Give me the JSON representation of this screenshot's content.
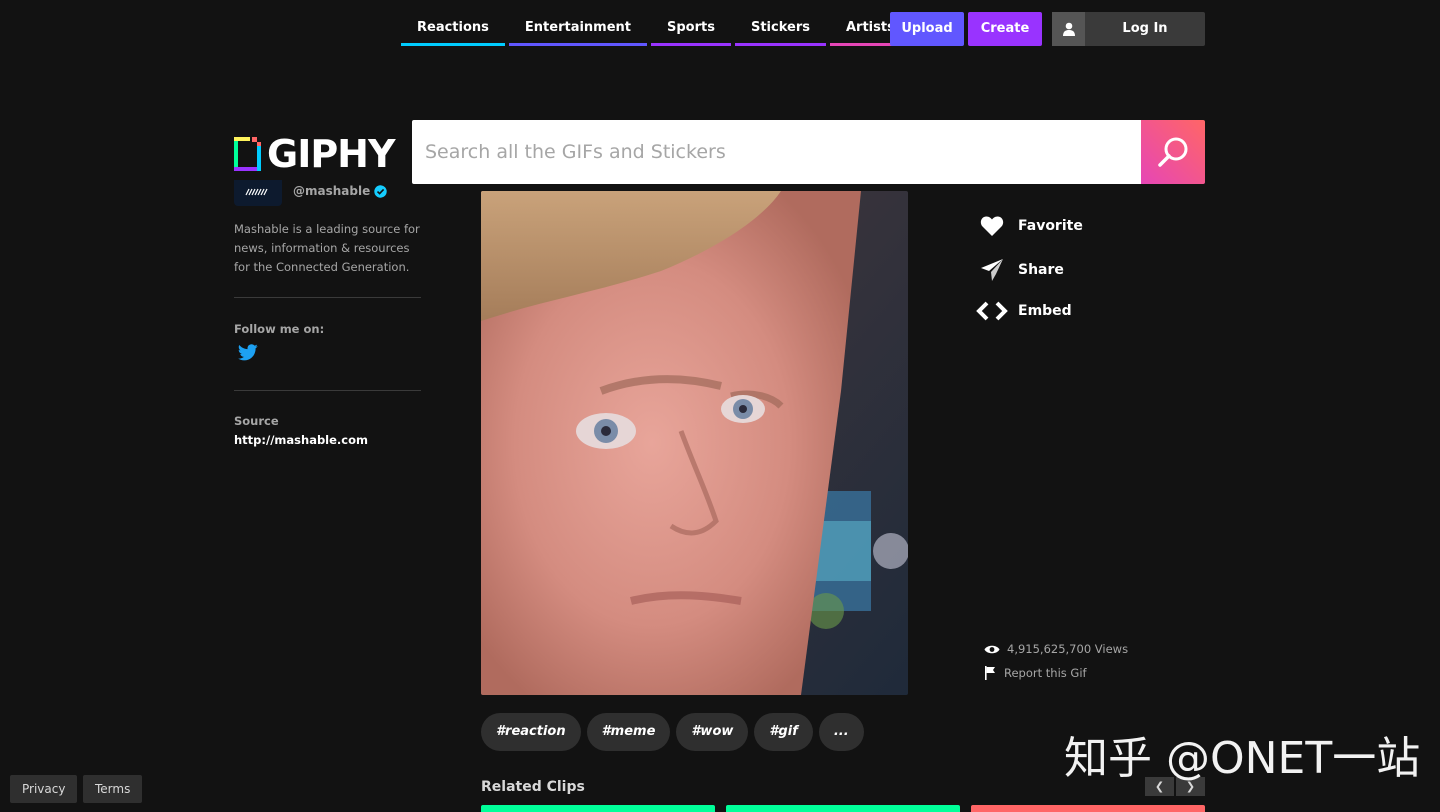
{
  "nav": {
    "items": [
      {
        "label": "Reactions",
        "color": "#00ccff"
      },
      {
        "label": "Entertainment",
        "color": "#6157ff"
      },
      {
        "label": "Sports",
        "color": "#9933ff"
      },
      {
        "label": "Stickers",
        "color": "#9933ff"
      },
      {
        "label": "Artists",
        "color": "#e646b6"
      }
    ],
    "more_color": "#e646b6",
    "upload_label": "Upload",
    "create_label": "Create",
    "login_label": "Log In"
  },
  "logo": {
    "text": "GIPHY"
  },
  "search": {
    "placeholder": "Search all the GIFs and Stickers"
  },
  "channel": {
    "handle": "@mashable",
    "bio": "Mashable is a leading source for news, information & resources for the Connected Generation.",
    "follow_label": "Follow me on:",
    "source_label": "Source",
    "source_link": "http://mashable.com"
  },
  "actions": {
    "favorite": "Favorite",
    "share": "Share",
    "embed": "Embed"
  },
  "stats": {
    "views": "4,915,625,700 Views",
    "report": "Report this Gif"
  },
  "tags": [
    "#reaction",
    "#meme",
    "#wow",
    "#gif",
    "..."
  ],
  "related": {
    "title": "Related Clips",
    "clip_colors": [
      "#00ff99",
      "#00ff99",
      "#ff6666"
    ]
  },
  "footer": {
    "privacy": "Privacy",
    "terms": "Terms"
  },
  "watermark": "知乎 @ONET一站"
}
